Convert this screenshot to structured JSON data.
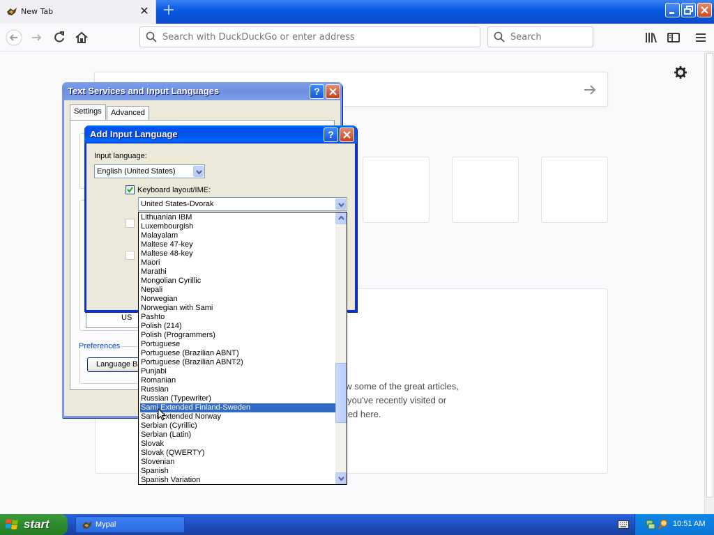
{
  "browser": {
    "tab_title": "New Tab",
    "tab_close": "✕",
    "new_tab": "+",
    "url_placeholder": "Search with DuckDuckGo or enter address",
    "search_placeholder": "Search"
  },
  "highlights": {
    "text_lines": [
      "ow some of the great articles,",
      "s you've recently visited or",
      "rked here."
    ]
  },
  "tsil_dialog": {
    "title": "Text Services and Input Languages",
    "tabs": [
      "Settings",
      "Advanced"
    ],
    "tree_partial": "US",
    "preferences_label": "Preferences",
    "language_bar_button": "Language Ba"
  },
  "add_lang_dialog": {
    "title": "Add Input Language",
    "input_language_label": "Input language:",
    "input_language_value": "English (United States)",
    "keyboard_layout_label": "Keyboard layout/IME:",
    "keyboard_layout_checked": true,
    "keyboard_layout_value": "United States-Dvorak",
    "layout_options": [
      "Lithuanian IBM",
      "Luxembourgish",
      "Malayalam",
      "Maltese 47-key",
      "Maltese 48-key",
      "Maori",
      "Marathi",
      "Mongolian Cyrillic",
      "Nepali",
      "Norwegian",
      "Norwegian with Sami",
      "Pashto",
      "Polish (214)",
      "Polish (Programmers)",
      "Portuguese",
      "Portuguese (Brazilian ABNT)",
      "Portuguese (Brazilian ABNT2)",
      "Punjabi",
      "Romanian",
      "Russian",
      "Russian (Typewriter)",
      "Sami Extended Finland-Sweden",
      "Sami Extended Norway",
      "Serbian (Cyrillic)",
      "Serbian (Latin)",
      "Slovak",
      "Slovak (QWERTY)",
      "Slovenian",
      "Spanish",
      "Spanish Variation"
    ],
    "selected_option": "Sami Extended Finland-Sweden"
  },
  "taskbar": {
    "start_label": "start",
    "task_label": "Mypal",
    "clock": "10:51 AM"
  },
  "colors": {
    "xp_title_blue": "#0053ee",
    "selection_blue": "#316ac5",
    "taskbar_blue": "#245edb",
    "start_green": "#2f8f2f"
  }
}
